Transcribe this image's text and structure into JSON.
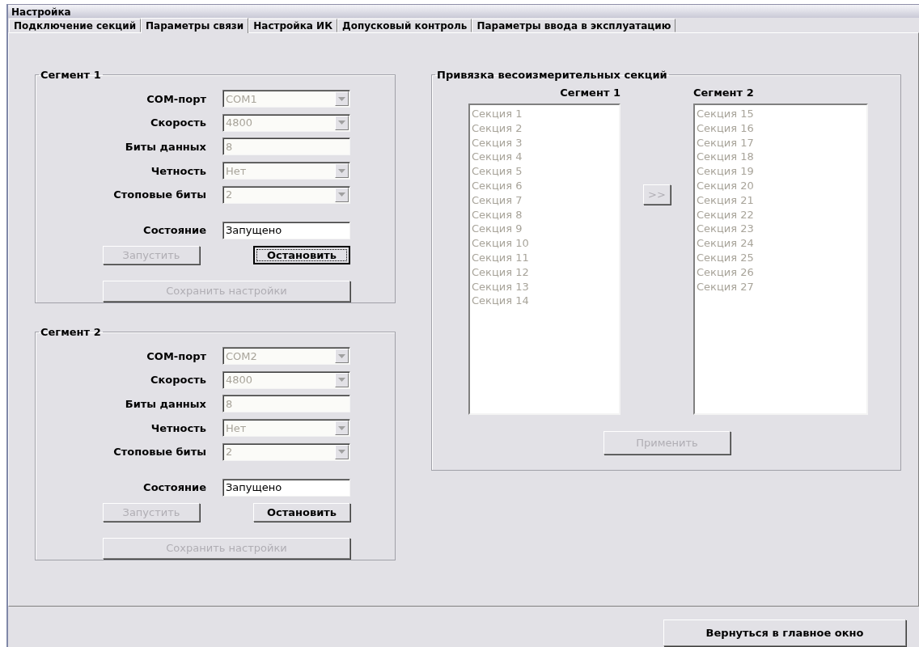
{
  "window": {
    "title": "Настройка"
  },
  "tabs": [
    {
      "label": "Подключение секций",
      "selected": false
    },
    {
      "label": "Параметры связи",
      "selected": true
    },
    {
      "label": "Настройка ИК",
      "selected": false
    },
    {
      "label": "Допусковый контроль",
      "selected": false
    },
    {
      "label": "Параметры ввода в эксплуатацию",
      "selected": false
    }
  ],
  "segments": [
    {
      "title": "Сегмент 1",
      "fields": [
        {
          "label": "COM-порт",
          "kind": "dropdown",
          "value": "COM1",
          "disabled": true
        },
        {
          "label": "Скорость",
          "kind": "dropdown",
          "value": "4800",
          "disabled": true
        },
        {
          "label": "Биты данных",
          "kind": "text",
          "value": "8",
          "disabled": true
        },
        {
          "label": "Четность",
          "kind": "dropdown",
          "value": "Нет",
          "disabled": true
        },
        {
          "label": "Стоповые биты",
          "kind": "dropdown",
          "value": "2",
          "disabled": true
        }
      ],
      "state": {
        "label": "Состояние",
        "value": "Запущено",
        "disabled": false
      },
      "buttons": [
        {
          "label": "Запустить",
          "disabled": true,
          "focused": false
        },
        {
          "label": "Остановить",
          "disabled": false,
          "focused": true
        }
      ],
      "save_button": {
        "label": "Сохранить настройки",
        "disabled": true
      }
    },
    {
      "title": "Сегмент 2",
      "fields": [
        {
          "label": "COM-порт",
          "kind": "dropdown",
          "value": "COM2",
          "disabled": true
        },
        {
          "label": "Скорость",
          "kind": "dropdown",
          "value": "4800",
          "disabled": true
        },
        {
          "label": "Биты данных",
          "kind": "text",
          "value": "8",
          "disabled": true
        },
        {
          "label": "Четность",
          "kind": "dropdown",
          "value": "Нет",
          "disabled": true
        },
        {
          "label": "Стоповые биты",
          "kind": "dropdown",
          "value": "2",
          "disabled": true
        }
      ],
      "state": {
        "label": "Состояние",
        "value": "Запущено",
        "disabled": false
      },
      "buttons": [
        {
          "label": "Запустить",
          "disabled": true,
          "focused": false
        },
        {
          "label": "Остановить",
          "disabled": false,
          "focused": false
        }
      ],
      "save_button": {
        "label": "Сохранить настройки",
        "disabled": true
      }
    }
  ],
  "binding": {
    "title": "Привязка весоизмерительных секций",
    "columns": [
      {
        "header": "Сегмент 1",
        "disabled": true,
        "items": [
          "Секция 1",
          "Секция 2",
          "Секция 3",
          "Секция 4",
          "Секция 5",
          "Секция 6",
          "Секция 7",
          "Секция 8",
          "Секция 9",
          "Секция 10",
          "Секция 11",
          "Секция 12",
          "Секция 13",
          "Секция 14"
        ]
      },
      {
        "header": "Сегмент 2",
        "disabled": true,
        "items": [
          "Секция 15",
          "Секция 16",
          "Секция 17",
          "Секция 18",
          "Секция 19",
          "Секция 20",
          "Секция 21",
          "Секция 22",
          "Секция 23",
          "Секция 24",
          "Секция 25",
          "Секция 26",
          "Секция 27"
        ]
      }
    ],
    "move_button": {
      "label": ">>",
      "disabled": true
    },
    "apply_button": {
      "label": "Применить",
      "disabled": true
    }
  },
  "footer_button": {
    "label": "Вернуться в главное окно"
  }
}
